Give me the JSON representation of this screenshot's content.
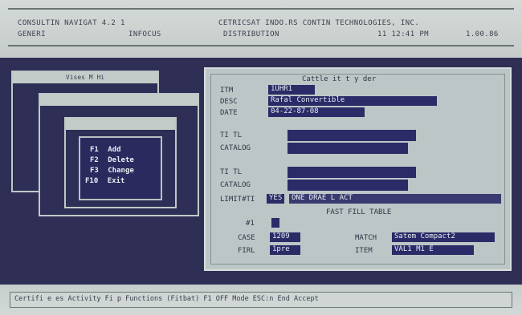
{
  "header": {
    "line1_left": "CONSULTIN NAVIGAT 4.2 1",
    "line1_mid": "CETRICSAT INDO.RS CONTIN TECHNOLOGIES, INC.",
    "line2_left": "GENERI",
    "line2_mid1": "INFOCUS",
    "line2_mid2": "DISTRIBUTION",
    "line2_right1": "11 12:41 PM",
    "line2_right2": "1.00.86"
  },
  "windows": {
    "back_title": "Vises M Hi",
    "mid_title": "",
    "front_title": ""
  },
  "menu": {
    "items": [
      {
        "key": "F1",
        "label": "Add"
      },
      {
        "key": "F2",
        "label": "Delete"
      },
      {
        "key": "F3",
        "label": "Change"
      },
      {
        "key": "F10",
        "label": "Exit"
      }
    ]
  },
  "panel": {
    "title": "Cattle it t  y der",
    "rows": {
      "r1_label": "ITM",
      "r1_value": "1UHR1",
      "r2_label": "DESC",
      "r2_value": "Rafal Convertible",
      "r3_label": "DATE",
      "r3_value": "04-22-87-08",
      "r4_label": "TI TL",
      "r5_label": "CATALOG",
      "r6_label": "TI TL",
      "r7_label": "CATALOG",
      "r8_label": "LIMIT#TI",
      "r8_value": "YES",
      "r8_extra": "ONE DRAE L  ACT",
      "subheading": "FAST FILL TABLE",
      "r9_label": "#1",
      "r10_label": "CASE",
      "r10_value": "1209",
      "r11_label": "FIRL",
      "r11_value": "1pre",
      "r10_right_label": "MATCH",
      "r10_right_value": "Satem Compact2",
      "r11_right_label": "ITEM",
      "r11_right_value": "VAL1 M1  E"
    }
  },
  "statusline": {
    "text": "Certifi e es Activity  Fi p Functions  (Fitbat)  F1 OFF Mode  ESC:n End  Accept"
  },
  "colors": {
    "workspace": "#2f2f55",
    "panel": "#bcc6c6",
    "field": "#2b2b68",
    "chrome": "#c8d0cd"
  }
}
